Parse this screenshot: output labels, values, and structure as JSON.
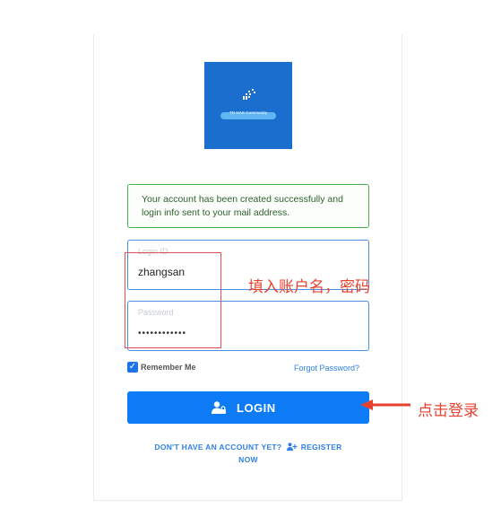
{
  "logo": {
    "text": "TN NAS Community"
  },
  "alert": {
    "message": "Your account has been created successfully and login info sent to your mail address."
  },
  "login_field": {
    "label": "Login ID",
    "value": "zhangsan"
  },
  "password_field": {
    "label": "Password",
    "value": "••••••••••••"
  },
  "annotations": {
    "fill_in": "填入账户名，密码",
    "click_login": "点击登录"
  },
  "remember": {
    "label": "Remember Me",
    "checked": true
  },
  "forgot": {
    "label": "Forgot Password?"
  },
  "login_button": {
    "label": "LOGIN",
    "icon": "user-lock-icon"
  },
  "signup": {
    "prompt": "DON'T HAVE AN ACCOUNT YET?",
    "link_line1": "REGISTER",
    "link_line2": "NOW",
    "icon": "user-plus-icon"
  },
  "colors": {
    "primary": "#0d7bf5",
    "success_border": "#4caf50",
    "annotation": "#e8402e",
    "logo_bg": "#1a6fce"
  }
}
